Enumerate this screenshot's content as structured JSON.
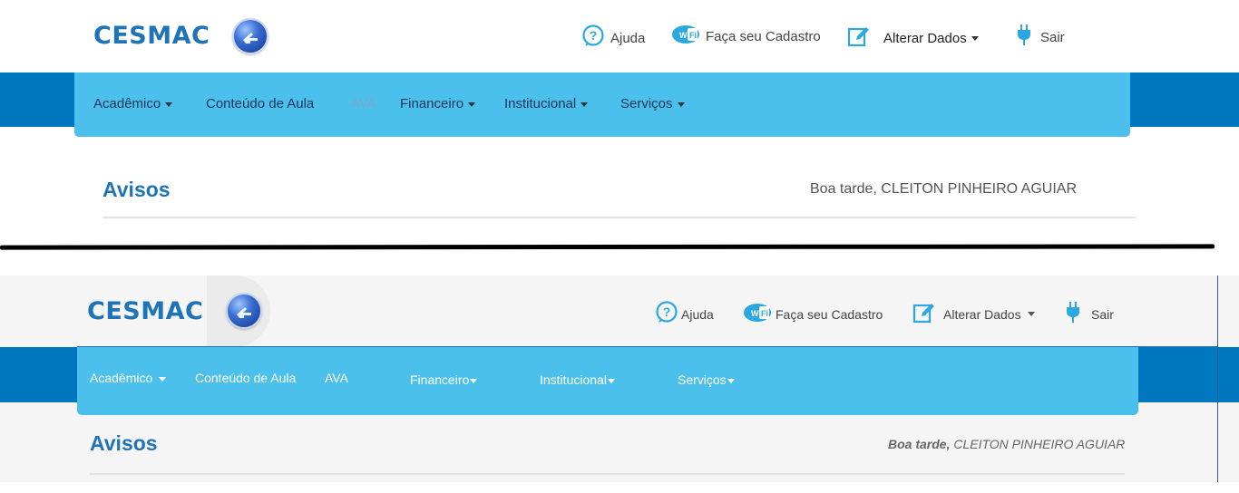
{
  "brand": {
    "name": "CESMAC"
  },
  "header_links": {
    "help": "Ajuda",
    "register": "Faça seu Cadastro",
    "edit_data": "Alterar Dados",
    "logout": "Sair"
  },
  "nav": {
    "academic": "Acadêmico",
    "class_content": "Conteúdo de Aula",
    "ava": "AVA",
    "financial": "Financeiro",
    "institutional": "Institucional",
    "services": "Serviços"
  },
  "notices": {
    "title": "Avisos",
    "greeting_prefix": "Boa tarde,",
    "user_name": "CLEITON PINHEIRO AGUIAR",
    "greeting_full": "Boa tarde, CLEITON PINHEIRO AGUIAR"
  },
  "colors": {
    "brand_blue": "#1f74b8",
    "band_blue": "#0077be",
    "nav_blue": "#4bc0ec",
    "icon_blue": "#2aa8df"
  }
}
